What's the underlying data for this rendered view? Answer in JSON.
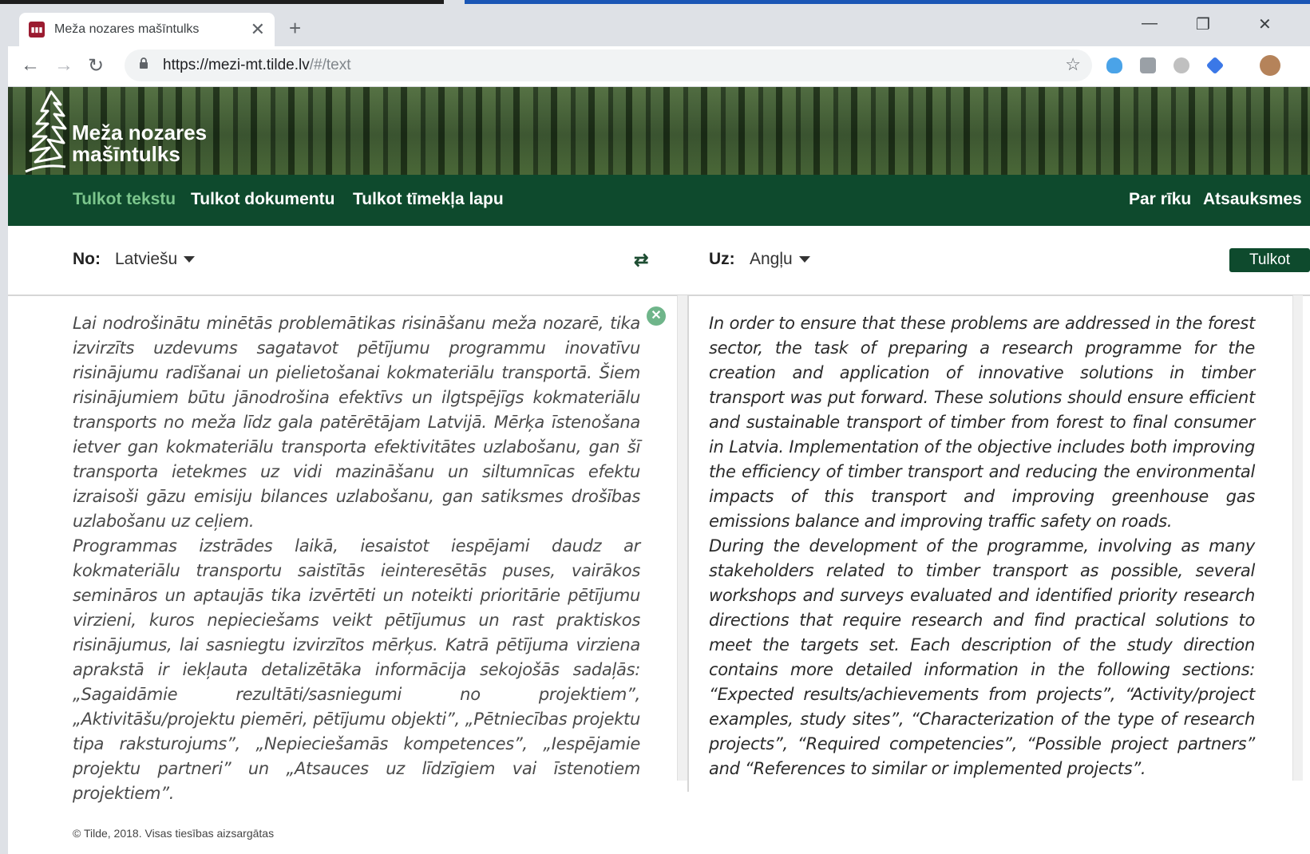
{
  "browser": {
    "tab_title": "Meža nozares mašīntulks",
    "tab_close": "✕",
    "new_tab": "+",
    "url_host": "https://mezi-mt.tilde.lv",
    "url_path": "/#/text",
    "win_minimize": "—",
    "win_restore": "❐",
    "win_close": "✕",
    "back": "←",
    "forward": "→",
    "reload": "↻",
    "lock": "🔒",
    "star": "☆",
    "menu": "⋮",
    "ext_colors": [
      "#4aa3e8",
      "#9aa0a6",
      "#b0b0b0",
      "#3b78e7"
    ]
  },
  "site": {
    "brand_line1": "Meža nozares",
    "brand_line2": "mašīntulks",
    "nav": {
      "text": "Tulkot tekstu",
      "document": "Tulkot dokumentu",
      "webpage": "Tulkot tīmekļa lapu",
      "about": "Par rīku",
      "feedback": "Atsauksmes"
    },
    "accent": "#0e4a2d",
    "active_color": "#7cc68d"
  },
  "translator": {
    "from_label": "No:",
    "from_lang": "Latviešu",
    "to_label": "Uz:",
    "to_lang": "Angļu",
    "swap_icon": "⇄",
    "translate_button": "Tulkot",
    "clear_icon": "✕",
    "source_paragraphs": [
      "Lai nodrošinātu minētās problemātikas risināšanu meža nozarē, tika izvirzīts uzdevums sagatavot pētījumu programmu inovatīvu risinājumu radīšanai un pielietošanai kokmateriālu transportā. Šiem risinājumiem būtu jānodrošina efektīvs un ilgtspējīgs kokmateriālu transports no meža līdz gala patērētājam Latvijā. Mērķa īstenošana ietver gan kokmateriālu transporta efektivitātes uzlabošanu, gan šī transporta ietekmes uz vidi mazināšanu un siltumnīcas efektu izraisoši gāzu emisiju bilances uzlabošanu, gan satiksmes drošības uzlabošanu uz ceļiem.",
      "Programmas izstrādes laikā, iesaistot iespējami daudz ar kokmateriālu transportu saistītās ieinteresētās puses, vairākos semināros un aptaujās tika izvērtēti un noteikti prioritārie pētījumu virzieni, kuros nepieciešams veikt pētījumus un rast praktiskos risinājumus, lai sasniegtu izvirzītos mērķus. Katrā pētījuma virziena aprakstā ir iekļauta detalizētāka informācija sekojošās sadaļās: „Sagaidāmie rezultāti/sasniegumi no projektiem”, „Aktivitāšu/projektu piemēri, pētījumu objekti”, „Pētniecības projektu tipa raksturojums”, „Nepieciešamās kompetences”, „Iespējamie projektu partneri” un „Atsauces uz līdzīgiem vai īstenotiem projektiem”."
    ],
    "target_paragraphs": [
      "In order to ensure that these problems are addressed in the forest sector, the task of preparing a research programme for the creation and application of innovative solutions in timber transport was put forward. These solutions should ensure efficient and sustainable transport of timber from forest to final consumer in Latvia. Implementation of the objective includes both improving the efficiency of timber transport and reducing the environmental impacts of this transport and improving greenhouse gas emissions balance and improving traffic safety on roads.",
      "During the development of the programme, involving as many stakeholders related to timber transport as possible, several workshops and surveys evaluated and identified priority research directions that require research and find practical solutions to meet the targets set. Each description of the study direction contains more detailed information in the following sections: “Expected results/achievements from projects”, “Activity/project examples, study sites”, “Characterization of the type of research projects”, “Required competencies”, “Possible project partners” and “References to similar or implemented projects”."
    ]
  },
  "footer": "© Tilde, 2018. Visas tiesības aizsargātas"
}
